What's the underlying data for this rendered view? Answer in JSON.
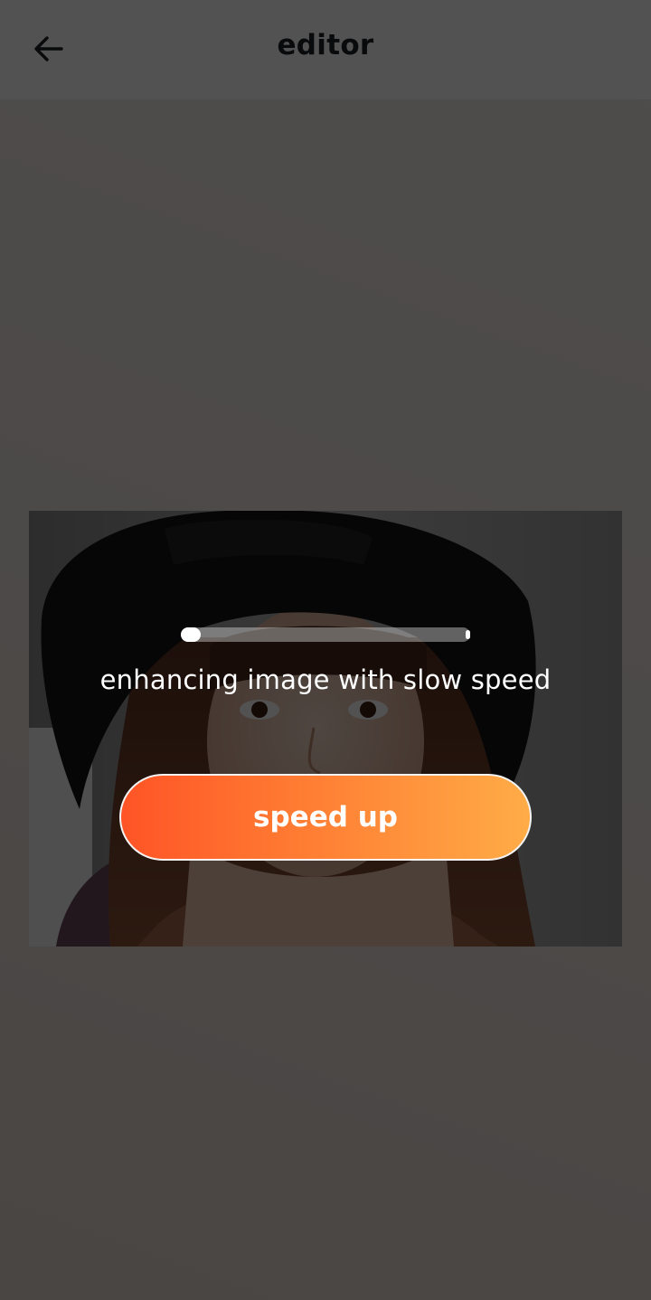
{
  "app_bar": {
    "title": "editor",
    "back_icon": "arrow-left-icon"
  },
  "preview": {
    "description_icon": "portrait-photo"
  },
  "progress": {
    "value": 0.04,
    "status_text": "enhancing image with slow speed"
  },
  "speed_up_button": {
    "label": "speed up"
  },
  "colors": {
    "button_gradient_start": "#ff5426",
    "button_gradient_end": "#ffac47",
    "scrim": "#000000"
  }
}
